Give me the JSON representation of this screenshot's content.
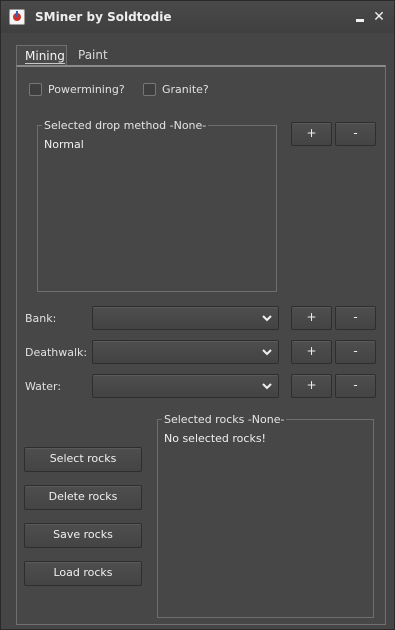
{
  "window": {
    "title": "SMiner by Soldtodie",
    "close_glyph": "✕"
  },
  "tabs": [
    {
      "label": "Mining",
      "active": true
    },
    {
      "label": "Paint",
      "active": false
    }
  ],
  "options": {
    "powermining_label": "Powermining?",
    "granite_label": "Granite?"
  },
  "drop_method": {
    "title": "Selected drop method  -None-",
    "items": [
      "Normal"
    ]
  },
  "buttons": {
    "plus": "+",
    "minus": "-"
  },
  "fields": {
    "bank_label": "Bank:",
    "deathwalk_label": "Deathwalk:",
    "water_label": "Water:"
  },
  "rocks": {
    "title": "Selected rocks  -None-",
    "empty_text": "No selected rocks!"
  },
  "actions": {
    "select": "Select rocks",
    "delete": "Delete rocks",
    "save": "Save rocks",
    "load": "Load rocks"
  },
  "colors": {
    "background": "#454545",
    "text": "#e8e8e8"
  },
  "icons": {
    "app": "java-cup-icon",
    "dropdown": "chevron-down-icon"
  }
}
